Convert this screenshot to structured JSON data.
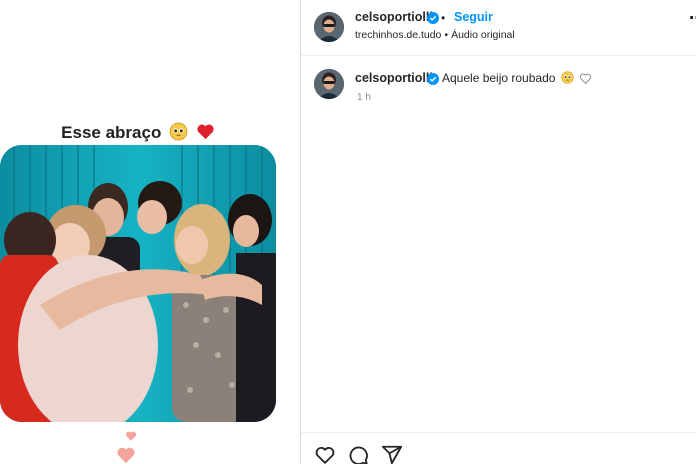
{
  "video": {
    "caption_text": "Esse abraço",
    "caption_emojis": [
      "pleading-face",
      "red-heart"
    ]
  },
  "post": {
    "author_username": "celsoportiolli",
    "verified": true,
    "follow_label": "Seguir",
    "separator": "•",
    "audio_account": "trechinhos.de.tudo",
    "audio_label": "Áudio original"
  },
  "comment": {
    "username": "celsoportiolli",
    "text": "Aquele beijo roubado",
    "emoji": "pleading-face",
    "time": "1 h"
  },
  "icons": {
    "actions": [
      "heart-icon",
      "comment-icon",
      "share-icon"
    ]
  },
  "colors": {
    "accent": "#0095f6",
    "verified": "#0095f6",
    "video_background": "#0f8fa0",
    "muted_text": "#8e8e8e"
  }
}
